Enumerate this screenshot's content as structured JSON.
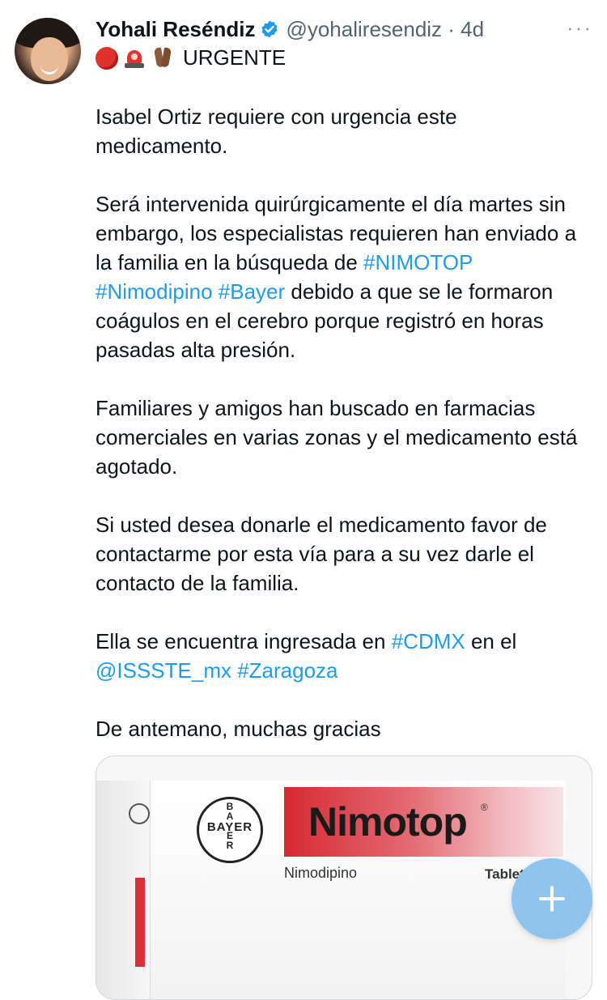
{
  "tweet": {
    "author_name": "Yohali Reséndiz",
    "handle_time": "@yohaliresendiz · 4d",
    "more_label": "···",
    "title": "URGENTE",
    "emojis": [
      "red-circle-emoji",
      "police-light-emoji",
      "folded-hands-emoji"
    ],
    "paragraphs": [
      [
        {
          "t": "Isabel Ortiz requiere con urgencia este medicamento."
        }
      ],
      [
        {
          "t": "Será intervenida quirúrgicamente el día martes sin embargo, los especialistas requieren han enviado a la familia en la búsqueda de "
        },
        {
          "t": "#NIMOTOP",
          "tag": true
        },
        {
          "t": " "
        },
        {
          "t": "#Nimodipino",
          "tag": true
        },
        {
          "t": " "
        },
        {
          "t": "#Bayer",
          "tag": true
        },
        {
          "t": " debido a que se le formaron coágulos en el cerebro porque registró en horas pasadas alta presión."
        }
      ],
      [
        {
          "t": "Familiares y amigos han buscado en farmacias comerciales en varias zonas y el medicamento está agotado."
        }
      ],
      [
        {
          "t": "Si usted desea donarle el medicamento favor de contactarme por esta vía para a su vez darle el contacto de la familia."
        }
      ],
      [
        {
          "t": "Ella se encuentra ingresada en "
        },
        {
          "t": "#CDMX",
          "tag": true
        },
        {
          "t": " en el "
        },
        {
          "t": "@ISSSTE_mx",
          "tag": true
        },
        {
          "t": " "
        },
        {
          "t": "#Zaragoza",
          "tag": true
        }
      ],
      [
        {
          "t": "De antemano, muchas gracias"
        }
      ]
    ]
  },
  "media": {
    "logo_h": "BAYER",
    "logo_v": [
      "B",
      "A",
      "",
      "E",
      "R"
    ],
    "brand": "Nimotop",
    "reg_mark": "®",
    "generic": "Nimodipino",
    "form": "Tabletas"
  },
  "colors": {
    "link": "#1d9bf0",
    "text": "#0f1419",
    "secondary": "#536471",
    "fab": "#8ec4ee"
  }
}
